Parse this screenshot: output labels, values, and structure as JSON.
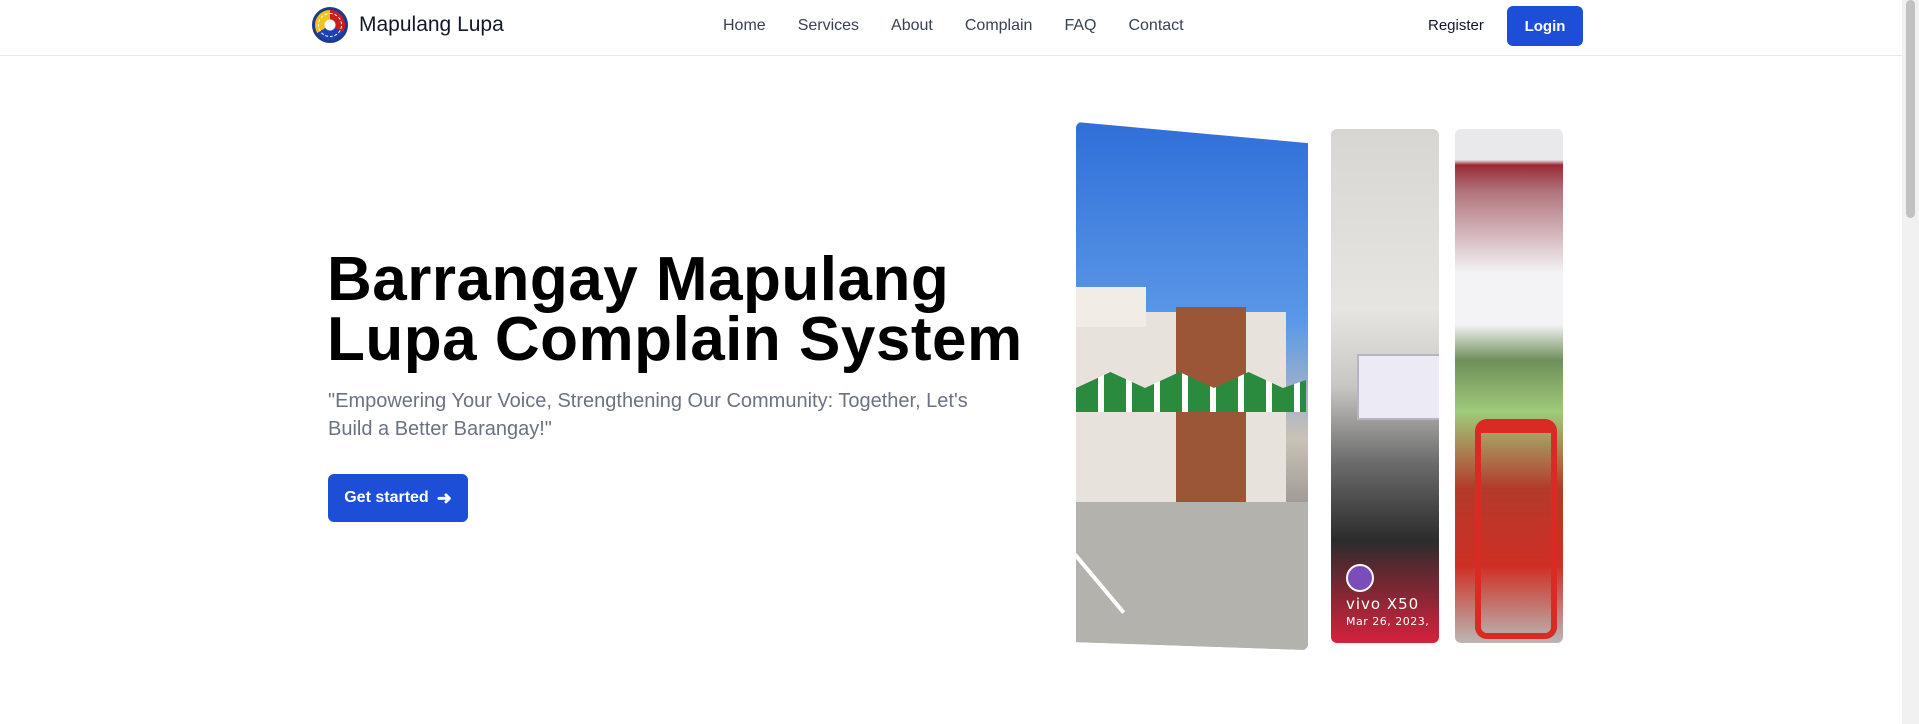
{
  "nav": {
    "brand": "Mapulang Lupa",
    "logo_icon": "barangay-seal-icon",
    "links": [
      "Home",
      "Services",
      "About",
      "Complain",
      "FAQ",
      "Contact"
    ],
    "register": "Register",
    "login": "Login"
  },
  "hero": {
    "title": "Barrangay Mapulang Lupa Complain System",
    "tagline": "\"Empowering Your Voice, Strengthening Our Community: Together, Let's Build a Better Barangay!\"",
    "cta": "Get started",
    "cta_icon": "arrow-right-icon"
  },
  "gallery": {
    "photo2_watermark_model": "vivo X50",
    "photo2_watermark_date": "Mar 26, 2023,"
  },
  "colors": {
    "accent": "#1d4ed8",
    "text": "#000000",
    "muted": "#6b7280"
  }
}
